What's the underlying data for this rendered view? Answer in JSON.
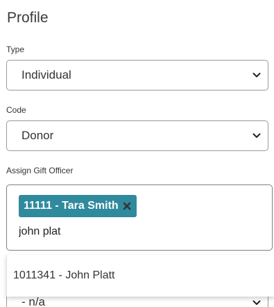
{
  "page": {
    "title": "Profile"
  },
  "type_field": {
    "label": "Type",
    "value": "Individual"
  },
  "code_field": {
    "label": "Code",
    "value": "Donor"
  },
  "gift_officer_field": {
    "label": "Assign Gift Officer",
    "selected_chips": [
      {
        "label": "11111 - Tara Smith"
      }
    ],
    "search_value": "john plat",
    "dropdown_options": [
      {
        "label": "1011341 - John Platt"
      }
    ]
  },
  "next_field": {
    "value": "- n/a"
  },
  "colors": {
    "chip_background": "#2f8a9e",
    "chip_text": "#ffffff",
    "chip_remove_icon": "#333333"
  }
}
